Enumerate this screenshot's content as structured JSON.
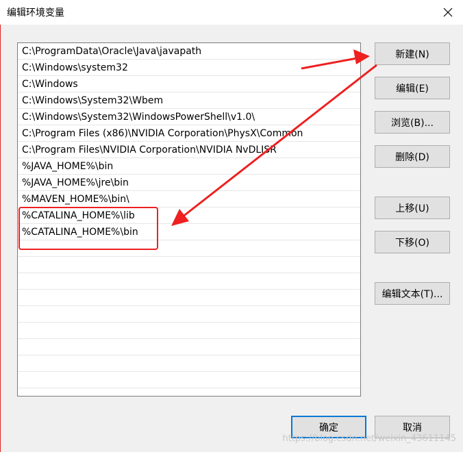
{
  "window": {
    "title": "编辑环境变量",
    "close_glyph": "close-icon"
  },
  "path_list": {
    "items": [
      "C:\\ProgramData\\Oracle\\Java\\javapath",
      "C:\\Windows\\system32",
      "C:\\Windows",
      "C:\\Windows\\System32\\Wbem",
      "C:\\Windows\\System32\\WindowsPowerShell\\v1.0\\",
      "C:\\Program Files (x86)\\NVIDIA Corporation\\PhysX\\Common",
      "C:\\Program Files\\NVIDIA Corporation\\NVIDIA NvDLISR",
      "%JAVA_HOME%\\bin",
      "%JAVA_HOME%\\jre\\bin",
      "%MAVEN_HOME%\\bin\\",
      "%CATALINA_HOME%\\lib",
      "%CATALINA_HOME%\\bin"
    ],
    "empty_rows": 9
  },
  "buttons": {
    "new": "新建(N)",
    "edit": "编辑(E)",
    "browse": "浏览(B)...",
    "delete": "删除(D)",
    "move_up": "上移(U)",
    "move_down": "下移(O)",
    "edit_text": "编辑文本(T)...",
    "ok": "确定",
    "cancel": "取消"
  },
  "annotations": {
    "color": "#ee2020"
  },
  "watermark": "https://blog.csdn.net/weixin_43611145"
}
